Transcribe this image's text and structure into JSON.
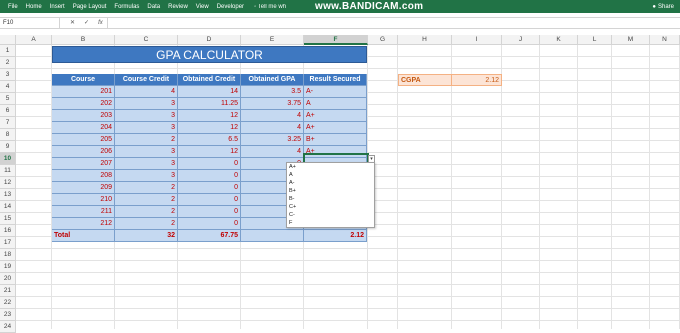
{
  "ribbon": {
    "tabs": [
      "File",
      "Home",
      "Insert",
      "Page Layout",
      "Formulas",
      "Data",
      "Review",
      "View",
      "Developer"
    ],
    "tell_me": "Tell me wh",
    "watermark": "www.BANDICAM.com",
    "share": "Share"
  },
  "formula_bar": {
    "name_box": "F10",
    "cancel": "✕",
    "enter": "✓",
    "fx": "fx",
    "content": ""
  },
  "columns": [
    "A",
    "B",
    "C",
    "D",
    "E",
    "F",
    "G",
    "H",
    "I",
    "J",
    "K",
    "L",
    "M",
    "N"
  ],
  "selected_column": "F",
  "rows": [
    "1",
    "2",
    "3",
    "4",
    "5",
    "6",
    "7",
    "8",
    "9",
    "10",
    "11",
    "12",
    "13",
    "14",
    "15",
    "16",
    "17",
    "18",
    "19",
    "20",
    "21",
    "22",
    "23",
    "24"
  ],
  "selected_row": "10",
  "title": "GPA CALCULATOR",
  "table": {
    "headers": [
      "Course",
      "Course Credit",
      "Obtained Credit",
      "Obtained GPA",
      "Result Secured"
    ],
    "rows": [
      [
        "201",
        "4",
        "14",
        "3.5",
        "A-"
      ],
      [
        "202",
        "3",
        "11.25",
        "3.75",
        "A"
      ],
      [
        "203",
        "3",
        "12",
        "4",
        "A+"
      ],
      [
        "204",
        "3",
        "12",
        "4",
        "A+"
      ],
      [
        "205",
        "2",
        "6.5",
        "3.25",
        "B+"
      ],
      [
        "206",
        "3",
        "12",
        "4",
        "A+"
      ],
      [
        "207",
        "3",
        "0",
        "0",
        ""
      ],
      [
        "208",
        "3",
        "0",
        "",
        ""
      ],
      [
        "209",
        "2",
        "0",
        "",
        ""
      ],
      [
        "210",
        "2",
        "0",
        "",
        ""
      ],
      [
        "211",
        "2",
        "0",
        "",
        ""
      ],
      [
        "212",
        "2",
        "0",
        "",
        ""
      ]
    ],
    "total": [
      "Total",
      "32",
      "67.75",
      "",
      "2.12"
    ]
  },
  "cgpa": {
    "label": "CGPA",
    "value": "2.12"
  },
  "dropdown": {
    "arrow": "▾",
    "options": [
      "A+",
      "A",
      "A-",
      "B+",
      "B-",
      "C+",
      "C-",
      "F"
    ]
  }
}
